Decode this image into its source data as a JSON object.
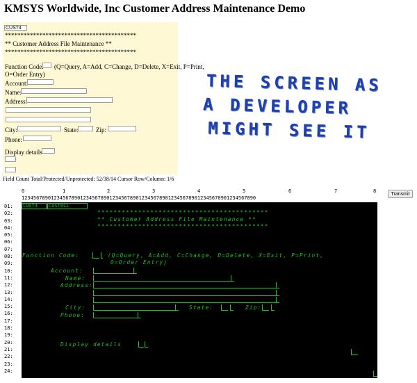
{
  "page": {
    "title": "KMSYS Worldwide, Inc Customer Address Maintenance Demo"
  },
  "form": {
    "program_field": "CUST4",
    "stars_line": "******************************************",
    "heading": "**  Customer Address File Maintenance  **",
    "function_label": "Function Code:",
    "function_help": "(Q=Query, A=Add, C=Change, D=Delete, X=Exit, P=Print,",
    "function_help2": "O=Order Entry)",
    "account_label": "Account:",
    "name_label": "Name:",
    "address_label": "Address:",
    "city_label": "City:",
    "state_label": "State:",
    "zip_label": "Zip:",
    "phone_label": "Phone:",
    "details_label": "Display details"
  },
  "status": "Field Count Total/Protected/Unprotected: 52/38/14 Cursor Row/Column: 1/6",
  "overlay": {
    "line1": "THE SCREEN AS",
    "line2": "A DEVELOPER",
    "line3": "MIGHT SEE IT"
  },
  "ruler": {
    "tens": [
      "0",
      "1",
      "2",
      "3",
      "4",
      "5",
      "6",
      "7",
      "8"
    ],
    "digits": "12345678901234567890123456789012345678901234567890123456789012345678901234567890"
  },
  "transmit_label": "Transmit",
  "row_numbers": [
    "01:",
    "02:",
    "03:",
    "04:",
    "05:",
    "06:",
    "07:",
    "08:",
    "09:",
    "10:",
    "11:",
    "12:",
    "13:",
    "14:",
    "15:",
    "16:",
    "17:",
    "18:",
    "19:",
    "20:",
    "21:",
    "22:",
    "23:",
    "24:"
  ],
  "terminal": {
    "program": "CUST4",
    "program2": "CUST0CL",
    "stars": "******************************************",
    "heading": "**  Customer Address File Maintenance  **",
    "function_label": "Function Code:",
    "function_help": "(Q=Query, A=Add, C=Change, D=Delete, X=Exit, P=Print,",
    "function_help2": "O=Order Entry)",
    "account_label": "Account:",
    "name_label": "Name:",
    "address_label": "Address:",
    "city_label": "City:",
    "state_label": "State:",
    "zip_label": "Zip:",
    "phone_label": "Phone:",
    "details_label": "Display details"
  },
  "colors": {
    "terminal_bg": "#000000",
    "terminal_fg": "#21c421",
    "form_bg": "#fef8d4",
    "overlay": "#1f3faa"
  }
}
